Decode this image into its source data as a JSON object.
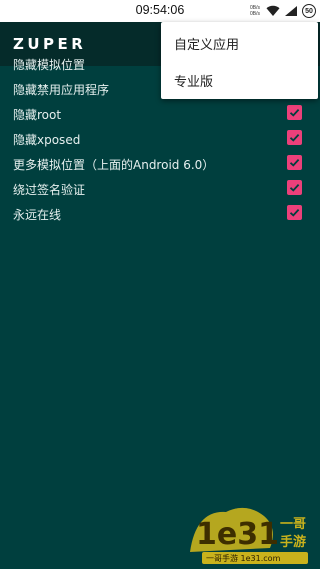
{
  "status_bar": {
    "time": "09:54:06",
    "net_up": "0B/s",
    "net_down": "0B/s",
    "battery": "50"
  },
  "app_bar": {
    "title": "ZUPER"
  },
  "options": [
    {
      "label": "隐藏模拟位置",
      "checked": false,
      "checkbox_visible": false
    },
    {
      "label": "隐藏禁用应用程序",
      "checked": true,
      "checkbox_visible": true
    },
    {
      "label": "隐藏root",
      "checked": true,
      "checkbox_visible": true
    },
    {
      "label": "隐藏xposed",
      "checked": true,
      "checkbox_visible": true
    },
    {
      "label": "更多模拟位置（上面的Android 6.0）",
      "checked": true,
      "checkbox_visible": true
    },
    {
      "label": "绕过签名验证",
      "checked": true,
      "checkbox_visible": true
    },
    {
      "label": "永远在线",
      "checked": true,
      "checkbox_visible": true
    }
  ],
  "overflow_menu": {
    "items": [
      "自定义应用",
      "专业版"
    ]
  },
  "watermark": {
    "brand": "1e31",
    "text_right_top": "一哥",
    "text_right_bottom": "手游",
    "footer": "一哥手游 1e31.com"
  },
  "colors": {
    "background": "#003f3e",
    "app_bar": "#052b2a",
    "checkbox_accent": "#ec407a",
    "menu_background": "#ffffff"
  }
}
